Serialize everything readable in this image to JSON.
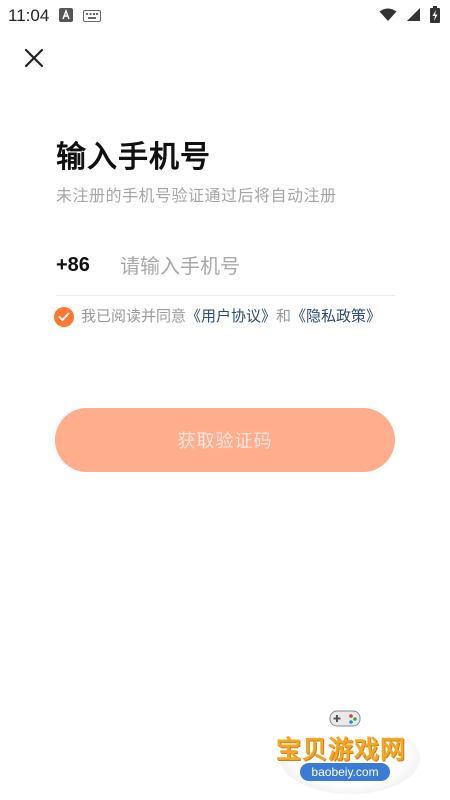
{
  "status_bar": {
    "time": "11:04",
    "icons": [
      "a-icon",
      "keyboard-icon",
      "wifi-icon",
      "signal-icon",
      "battery-charging-icon"
    ]
  },
  "header": {
    "close_icon": "close-icon"
  },
  "main": {
    "title": "输入手机号",
    "subtitle": "未注册的手机号验证通过后将自动注册",
    "phone": {
      "country_code": "+86",
      "placeholder": "请输入手机号",
      "value": ""
    },
    "agreement": {
      "checked": true,
      "prefix": "我已阅读并同意",
      "user_agreement": "《用户协议》",
      "joiner": "和",
      "privacy_policy": "《隐私政策》"
    },
    "submit_label": "获取验证码"
  },
  "watermark": {
    "brand": "宝贝游戏网",
    "domain": "baobeiy.com"
  },
  "colors": {
    "accent": "#ff7733",
    "button_disabled": "#ffad8c",
    "link": "#2c4a72",
    "muted_text": "#a5a5a5"
  }
}
